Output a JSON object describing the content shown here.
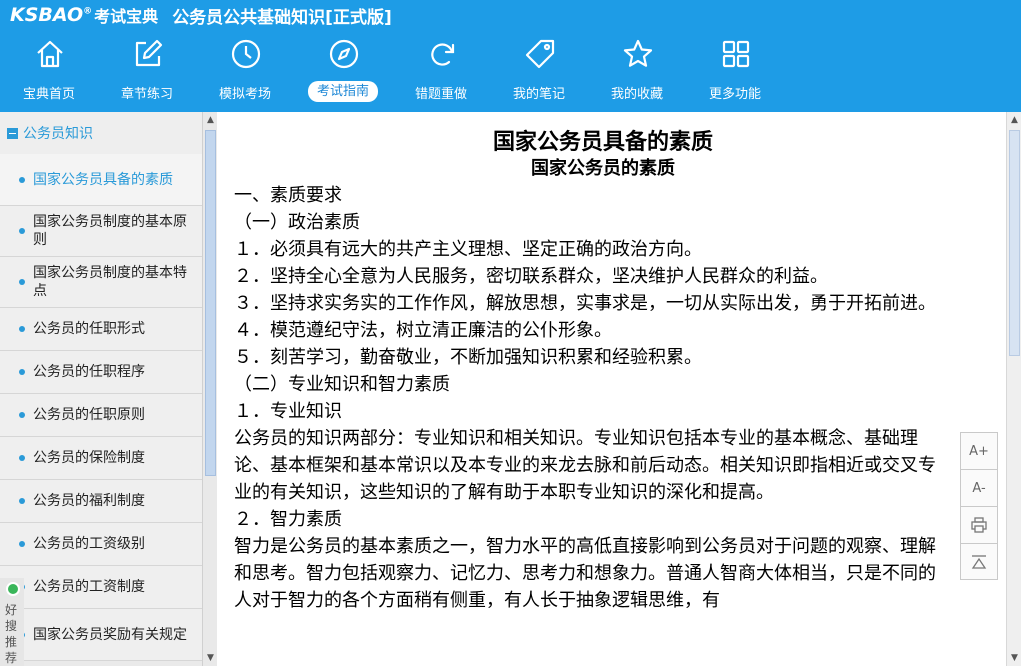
{
  "app": {
    "logo_text": "KSBAO",
    "logo_mark": "®",
    "logo_cn": "考试宝典",
    "title": "公务员公共基础知识[正式版]"
  },
  "nav": [
    {
      "label": "宝典首页",
      "icon": "home-icon"
    },
    {
      "label": "章节练习",
      "icon": "edit-icon"
    },
    {
      "label": "模拟考场",
      "icon": "clock-icon"
    },
    {
      "label": "考试指南",
      "icon": "compass-icon",
      "active": true
    },
    {
      "label": "错题重做",
      "icon": "refresh-icon"
    },
    {
      "label": "我的笔记",
      "icon": "tag-icon"
    },
    {
      "label": "我的收藏",
      "icon": "star-icon"
    },
    {
      "label": "更多功能",
      "icon": "grid-icon"
    }
  ],
  "sidebar": {
    "header": "公务员知识",
    "items": [
      {
        "label": "国家公务员具备的素质",
        "selected": true
      },
      {
        "label": "国家公务员制度的基本原则"
      },
      {
        "label": "国家公务员制度的基本特点"
      },
      {
        "label": "公务员的任职形式"
      },
      {
        "label": "公务员的任职程序"
      },
      {
        "label": "公务员的任职原则"
      },
      {
        "label": "公务员的保险制度"
      },
      {
        "label": "公务员的福利制度"
      },
      {
        "label": "公务员的工资级别"
      },
      {
        "label": "公务员的工资制度"
      },
      {
        "label": "国家公务员奖励有关规定"
      }
    ],
    "promo": "好搜推荐"
  },
  "document": {
    "title": "国家公务员具备的素质",
    "subtitle": "国家公务员的素质",
    "paragraphs": [
      "一、素质要求",
      "（一）政治素质",
      "１．必须具有远大的共产主义理想、坚定正确的政治方向。",
      "２．坚持全心全意为人民服务，密切联系群众，坚决维护人民群众的利益。",
      "３．坚持求实务实的工作作风，解放思想，实事求是，一切从实际出发，勇于开拓前进。",
      "４．模范遵纪守法，树立清正廉洁的公仆形象。",
      "５．刻苦学习，勤奋敬业，不断加强知识积累和经验积累。",
      "（二）专业知识和智力素质",
      "１．专业知识",
      "公务员的知识两部分：专业知识和相关知识。专业知识包括本专业的基本概念、基础理论、基本框架和基本常识以及本专业的来龙去脉和前后动态。相关知识即指相近或交叉专业的有关知识，这些知识的了解有助于本职专业知识的深化和提高。",
      "２．智力素质",
      "智力是公务员的基本素质之一，智力水平的高低直接影响到公务员对于问题的观察、理解和思考。智力包括观察力、记忆力、思考力和想象力。普通人智商大体相当，只是不同的人对于智力的各个方面稍有侧重，有人长于抽象逻辑思维，有"
    ]
  },
  "tools": {
    "font_increase": "A+",
    "font_decrease": "A-"
  }
}
